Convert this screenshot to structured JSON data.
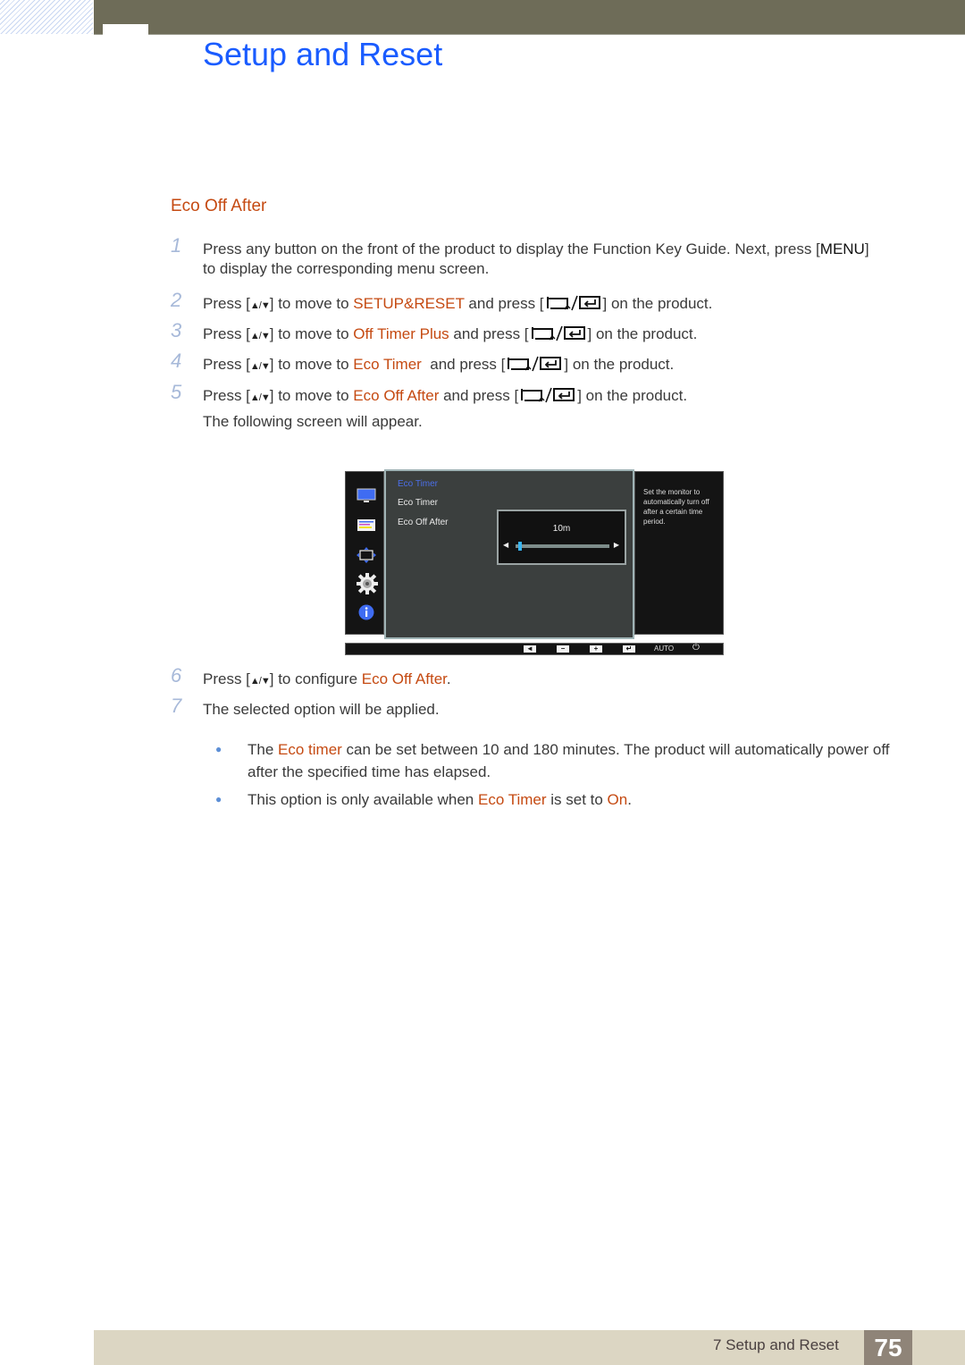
{
  "header": {
    "chapter_title": "Setup and Reset"
  },
  "section": {
    "title": "Eco Off After"
  },
  "steps": [
    {
      "num": "1",
      "pre": "Press any button on the front of the product to display the Function Key Guide. Next, press [",
      "key": "MENU",
      "post": "]",
      "line2": "to display the corresponding menu screen."
    },
    {
      "num": "2",
      "pre": "Press [",
      "arrows": "▲/▼",
      "mid": "] to move to ",
      "target": "SETUP&RESET",
      "mid2": " and press [",
      "post": "] on the product."
    },
    {
      "num": "3",
      "pre": "Press [",
      "arrows": "▲/▼",
      "mid": "] to move to ",
      "target": "Off Timer Plus",
      "mid2": " and press [",
      "post": "] on the product."
    },
    {
      "num": "4",
      "pre": "Press [",
      "arrows": "▲/▼",
      "mid": "] to move to ",
      "target": "Eco Timer",
      "mid2": "  and press [",
      "post": "] on the product."
    },
    {
      "num": "5",
      "pre": "Press [",
      "arrows": "▲/▼",
      "mid": "] to move to ",
      "target": "Eco Off After",
      "mid2": " and press [",
      "post": "] on the product."
    },
    {
      "num": "6",
      "pre": "Press [",
      "arrows": "▲/▼",
      "mid": "] to configure ",
      "target": "Eco Off After",
      "post": "."
    },
    {
      "num": "7",
      "text": "The selected option will be applied."
    }
  ],
  "following_screen_text": "The following screen will appear.",
  "osd": {
    "sidebar_icons": [
      "picture-icon",
      "color-icon",
      "size-position-icon",
      "setup-reset-icon",
      "information-icon"
    ],
    "menu_title": "Eco Timer",
    "items": [
      "Eco Timer",
      "Eco Off After"
    ],
    "value_label": "10m",
    "slider": {
      "min_minutes": 10,
      "max_minutes": 180,
      "value_minutes": 10,
      "fraction": 0.0
    },
    "help_text": "Set the monitor to automatically turn off after a certain time period.",
    "buttons": {
      "left": "◄",
      "minus": "−",
      "plus": "+",
      "enter": "↵",
      "auto": "AUTO",
      "power": "⏻"
    }
  },
  "notes": [
    {
      "pre": "The ",
      "hl": "Eco timer",
      "post": " can be set between 10 and 180 minutes. The product will automatically power off after the specified time has elapsed."
    },
    {
      "pre": "This option is only available when ",
      "hl": "Eco Timer",
      "mid": " is set to ",
      "hl2": "On",
      "post": "."
    }
  ],
  "footer": {
    "chapter_label": "7 Setup and Reset",
    "page_number": "75"
  },
  "colors": {
    "title_blue": "#1a5cff",
    "highlight_orange": "#c54a12",
    "step_number": "#a7b9d9",
    "header_bar": "#6e6c58",
    "footer_bar": "#dcd6c3",
    "page_badge": "#8f8478"
  }
}
